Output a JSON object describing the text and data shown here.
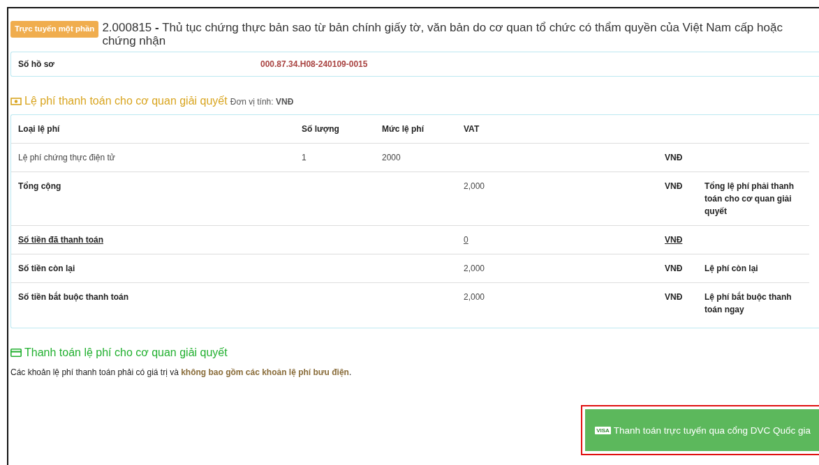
{
  "procedure": {
    "badge": "Trực tuyến một phần",
    "code": "2.000815",
    "separator": "-",
    "title": "Thủ tục chứng thực bản sao từ bản chính giấy tờ, văn bản do cơ quan tổ chức có thẩm quyền của Việt Nam cấp hoặc chứng nhận"
  },
  "file_info": {
    "label": "Số hồ sơ",
    "value": "000.87.34.H08-240109-0015"
  },
  "fees": {
    "title": "Lệ phí thanh toán cho cơ quan giải quyết",
    "unit_label": "Đơn vị tính:",
    "unit": "VNĐ",
    "columns": [
      "Loại lệ phí",
      "Số lượng",
      "Mức lệ phí",
      "VAT"
    ],
    "rows": [
      {
        "kind": "item",
        "name": "Lệ phí chứng thực điện tử",
        "quantity": "1",
        "rate": "2000",
        "currency": "VNĐ"
      },
      {
        "kind": "summary",
        "name": "Tổng cộng",
        "amount": "2,000",
        "currency": "VNĐ",
        "note": "Tổng lệ phí phải thanh toán cho cơ quan giải quyết"
      },
      {
        "kind": "link",
        "name": "Số tiền đã thanh toán",
        "amount": "0",
        "currency": "VNĐ"
      },
      {
        "kind": "summary",
        "name": "Số tiền còn lại",
        "amount": "2,000",
        "currency": "VNĐ",
        "note": "Lệ phí còn lại"
      },
      {
        "kind": "summary",
        "name": "Số tiền bắt buộc thanh toán",
        "amount": "2,000",
        "currency": "VNĐ",
        "note": "Lệ phí bắt buộc thanh toán ngay"
      }
    ]
  },
  "payment": {
    "title": "Thanh toán lệ phí cho cơ quan giải quyết",
    "notice": "Các khoản lệ phí thanh toán phải có giá trị và **không bao gồm các khoản lệ phí bưu điện**.",
    "card_label": "VISA",
    "button": "Thanh toán trực tuyến qua cổng DVC Quốc gia"
  }
}
